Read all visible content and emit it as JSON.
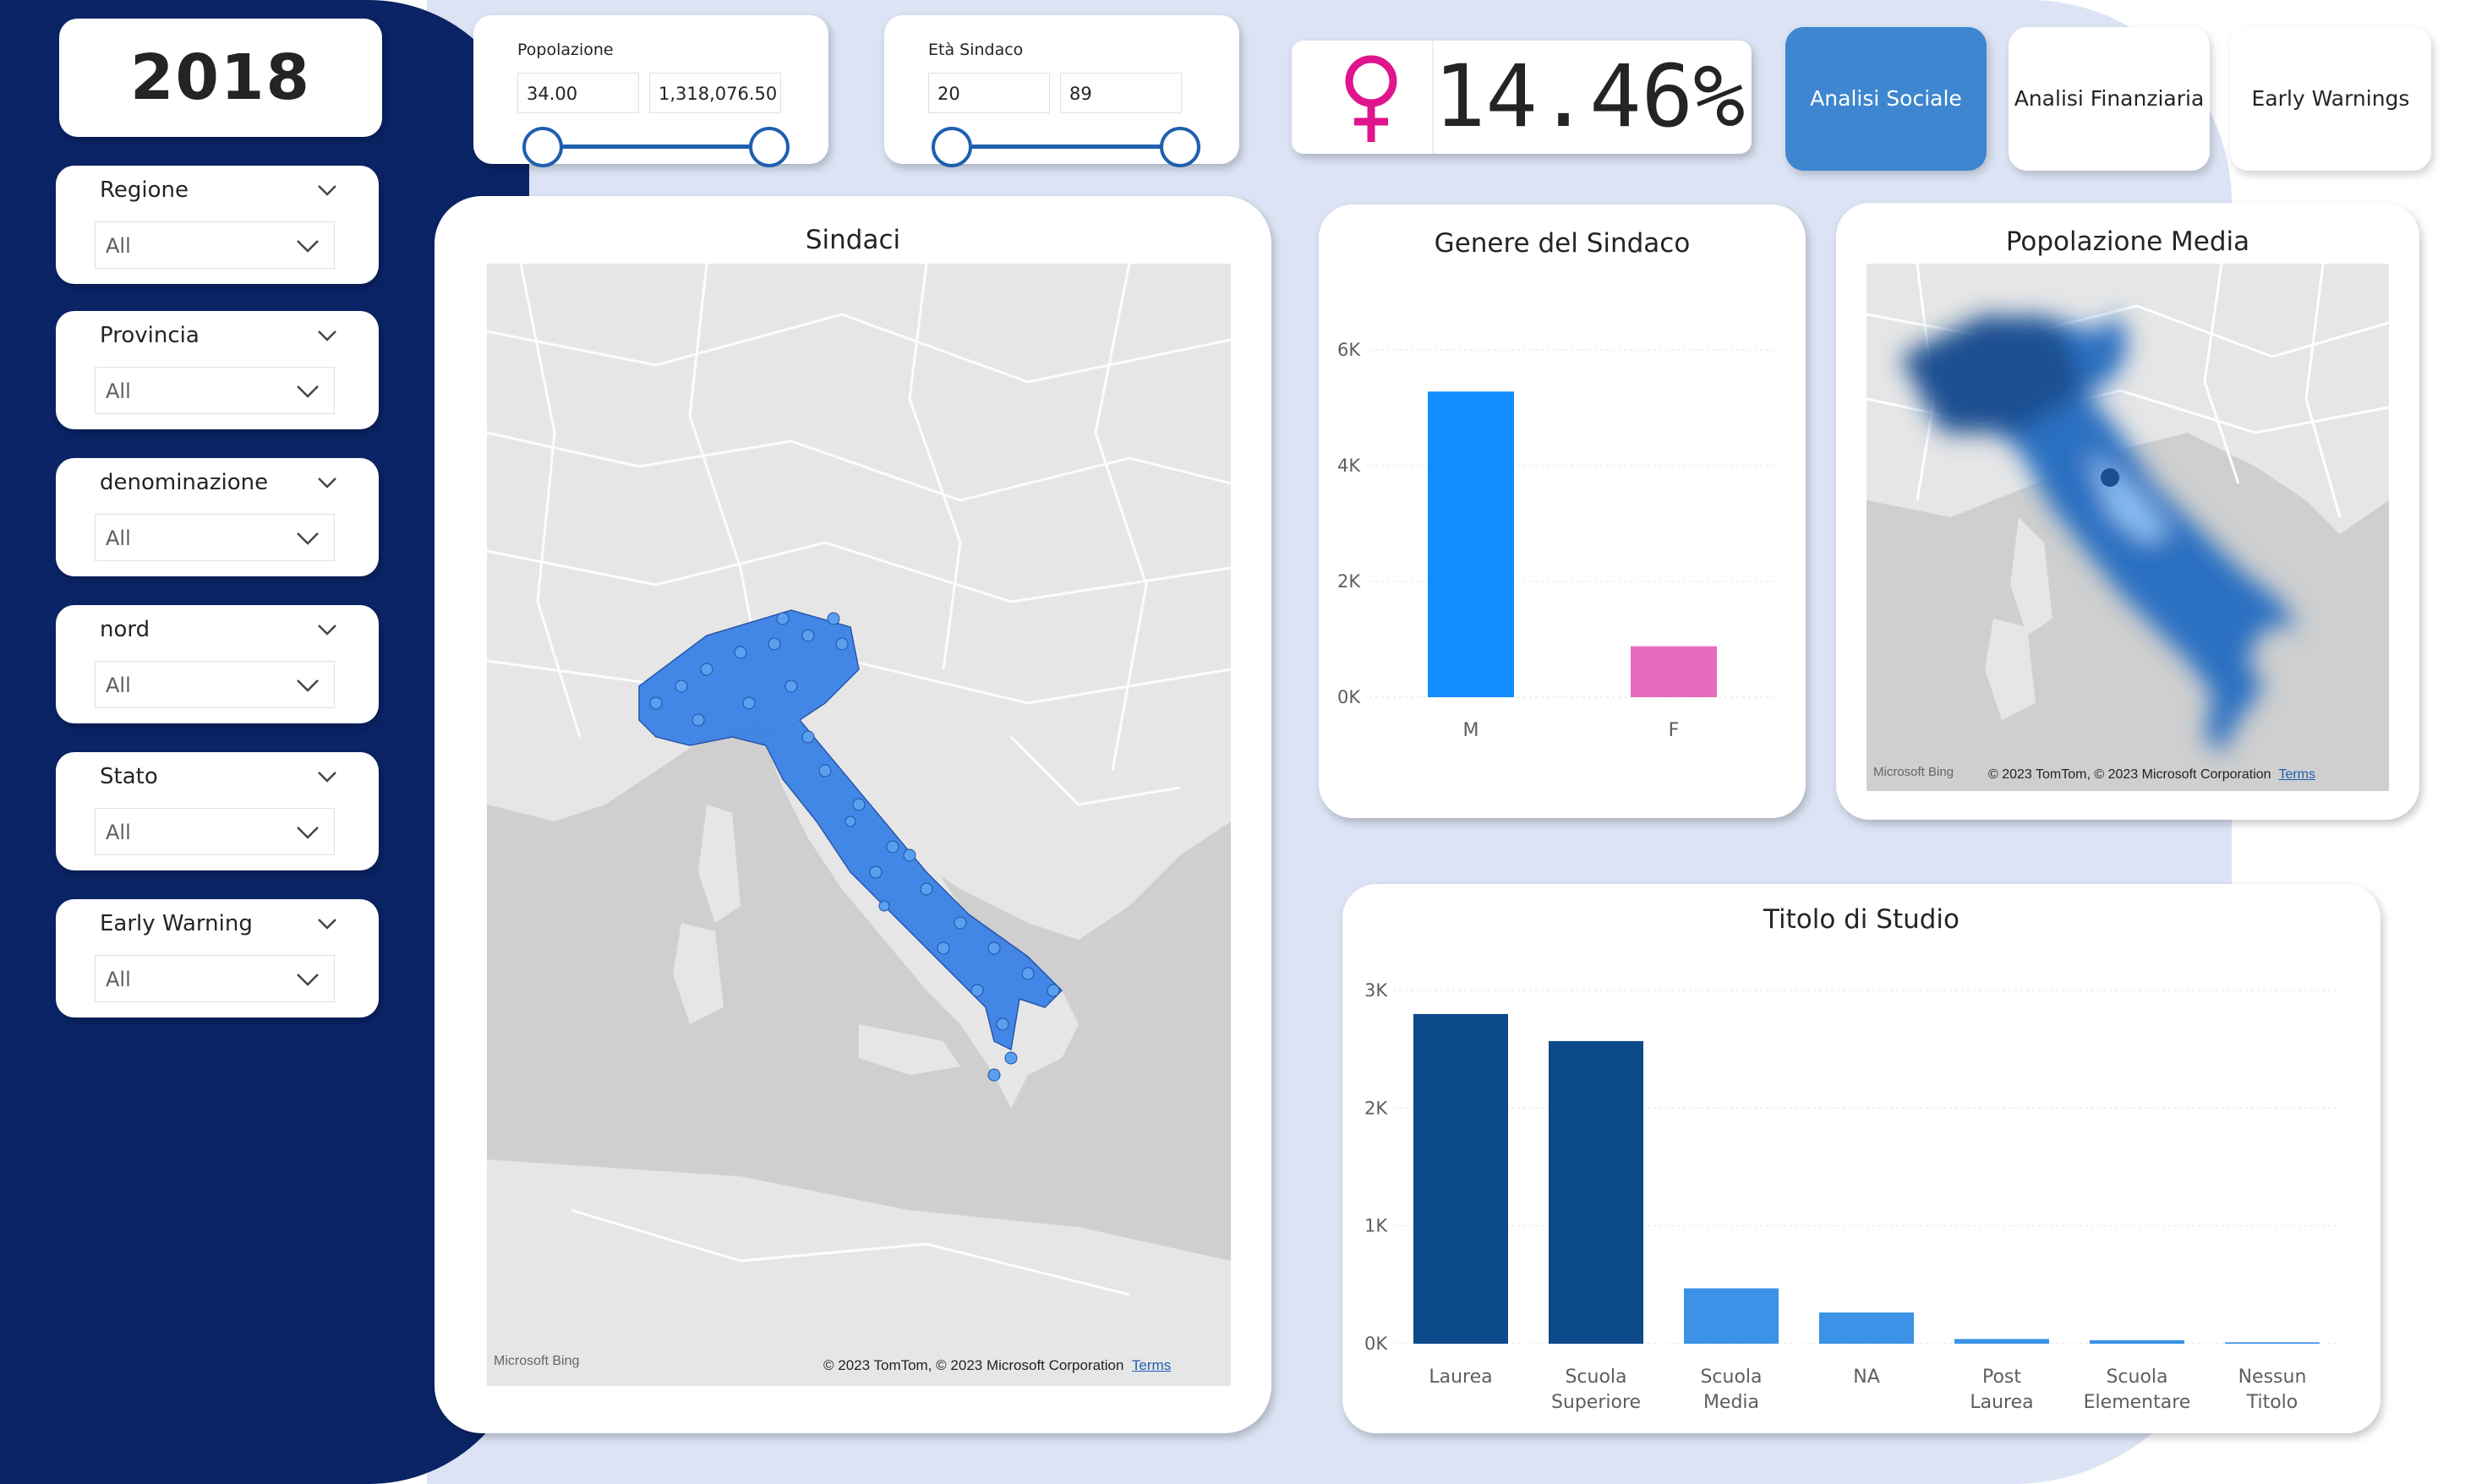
{
  "year": "2018",
  "slicers": [
    {
      "title": "Regione",
      "value": "All"
    },
    {
      "title": "Provincia",
      "value": "All"
    },
    {
      "title": "denominazione",
      "value": "All"
    },
    {
      "title": "nord",
      "value": "All"
    },
    {
      "title": "Stato",
      "value": "All"
    },
    {
      "title": "Early Warning",
      "value": "All"
    }
  ],
  "range_slicers": [
    {
      "title": "Popolazione",
      "min": "34.00",
      "max": "1,318,076.50"
    },
    {
      "title": "Età Sindaco",
      "min": "20",
      "max": "89"
    }
  ],
  "kpi": {
    "value": "14.46%",
    "icon": "female-symbol-icon",
    "icon_color": "#e0148c"
  },
  "nav_buttons": [
    {
      "label": "Analisi Sociale",
      "active": true
    },
    {
      "label": "Analisi Finanziaria",
      "active": false
    },
    {
      "label": "Early Warnings",
      "active": false
    }
  ],
  "maps": {
    "sindaci": {
      "title": "Sindaci",
      "provider": "Microsoft Bing",
      "credit": "© 2023 TomTom, © 2023 Microsoft Corporation",
      "terms": "Terms"
    },
    "popolazione": {
      "title": "Popolazione Media",
      "provider": "Microsoft Bing",
      "credit": "© 2023 TomTom, © 2023 Microsoft Corporation",
      "terms": "Terms"
    }
  },
  "colors": {
    "accent": "#3e86cf",
    "navy": "#0a2466",
    "male": "#118dff",
    "female": "#e66cbe",
    "dark_bar": "#0d4a8a",
    "mid_bar": "#3b92e6"
  },
  "chart_data": [
    {
      "type": "bar",
      "title": "Genere del Sindaco",
      "categories": [
        "M",
        "F"
      ],
      "values": [
        5280,
        880
      ],
      "yticks": [
        "0K",
        "2K",
        "4K",
        "6K"
      ],
      "ylim": [
        0,
        6000
      ],
      "grid": true
    },
    {
      "type": "bar",
      "title": "Titolo di Studio",
      "categories": [
        "Laurea",
        "Scuola Superiore",
        "Scuola Media",
        "NA",
        "Post Laurea",
        "Scuola Elementare",
        "Nessun Titolo"
      ],
      "values": [
        2800,
        2570,
        470,
        265,
        40,
        30,
        12
      ],
      "yticks": [
        "0K",
        "1K",
        "2K",
        "3K"
      ],
      "ylim": [
        0,
        3000
      ],
      "grid": true
    }
  ]
}
